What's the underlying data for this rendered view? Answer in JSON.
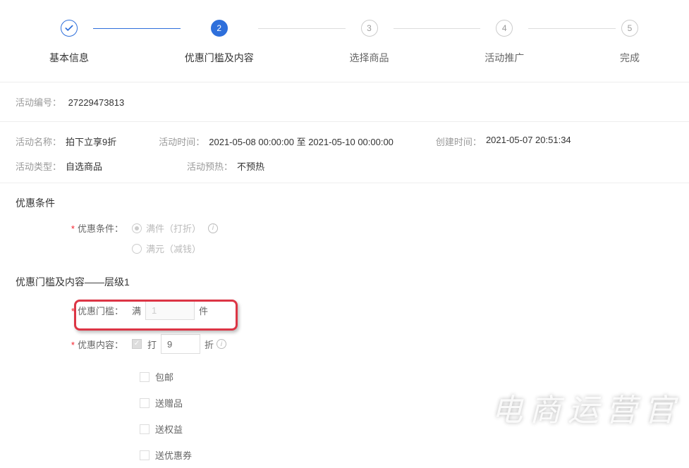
{
  "steps": {
    "s1": {
      "label": "基本信息"
    },
    "s2": {
      "label": "优惠门槛及内容",
      "num": "2"
    },
    "s3": {
      "label": "选择商品",
      "num": "3"
    },
    "s4": {
      "label": "活动推广",
      "num": "4"
    },
    "s5": {
      "label": "完成",
      "num": "5"
    }
  },
  "activity": {
    "id_label": "活动编号：",
    "id_value": "27229473813",
    "name_label": "活动名称：",
    "name_value": "拍下立享9折",
    "time_label": "活动时间：",
    "time_value": "2021-05-08 00:00:00 至 2021-05-10 00:00:00",
    "create_label": "创建时间：",
    "create_value": "2021-05-07 20:51:34",
    "type_label": "活动类型：",
    "type_value": "自选商品",
    "preheat_label": "活动预热：",
    "preheat_value": "不预热"
  },
  "conditions": {
    "title": "优惠条件",
    "label": "优惠条件：",
    "opt1": "满件（打折）",
    "opt2": "满元（减钱）"
  },
  "threshold": {
    "title": "优惠门槛及内容——层级1",
    "threshold_label": "优惠门槛：",
    "prefix_man": "满",
    "threshold_value": "1",
    "unit_jian": "件",
    "content_label": "优惠内容：",
    "prefix_da": "打",
    "discount_value": "9",
    "unit_zhe": "折",
    "free_ship": "包邮",
    "gift": "送赠品",
    "benefit": "送权益",
    "coupon": "送优惠券"
  },
  "watermark": "电商运营官"
}
